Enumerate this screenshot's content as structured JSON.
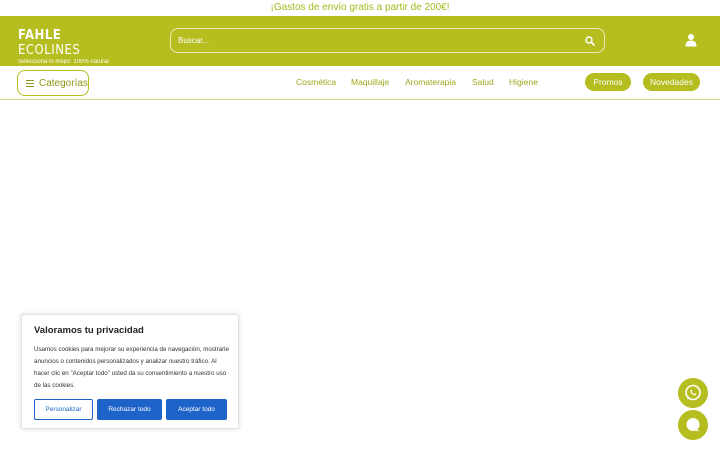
{
  "promo": {
    "text": "¡Gastos de envío gratis a partir de 200€!"
  },
  "logo": {
    "brand_bold": "FAHLE",
    "brand_light": "ECOLINES",
    "tagline": "Selecciona lo mejor. 100% natural"
  },
  "search": {
    "placeholder": "Buscar...",
    "icon": "search-icon"
  },
  "header": {
    "user_icon": "user-icon"
  },
  "nav": {
    "categories_label": "Categorías",
    "links": [
      "Cosmética",
      "Maquillaje",
      "Aromaterapia",
      "Salud",
      "Higiene"
    ],
    "pills": [
      "Promos",
      "Novedades"
    ]
  },
  "cookie": {
    "title": "Valoramos tu privacidad",
    "text": "Usamos cookies para mejorar su experiencia de navegación, mostrarle anuncios o contenidos personalizados y analizar nuestro tráfico. Al hacer clic en \"Aceptar todo\" usted da su consentimiento a nuestro uso de las cookies.",
    "customize_label": "Personalizar",
    "reject_label": "Rechazar todo",
    "accept_label": "Aceptar todo"
  },
  "floating": {
    "whatsapp_icon": "whatsapp-icon",
    "chat_icon": "chat-icon"
  },
  "colors": {
    "brand": "#b5bd1f",
    "button_blue": "#1e64c8"
  }
}
